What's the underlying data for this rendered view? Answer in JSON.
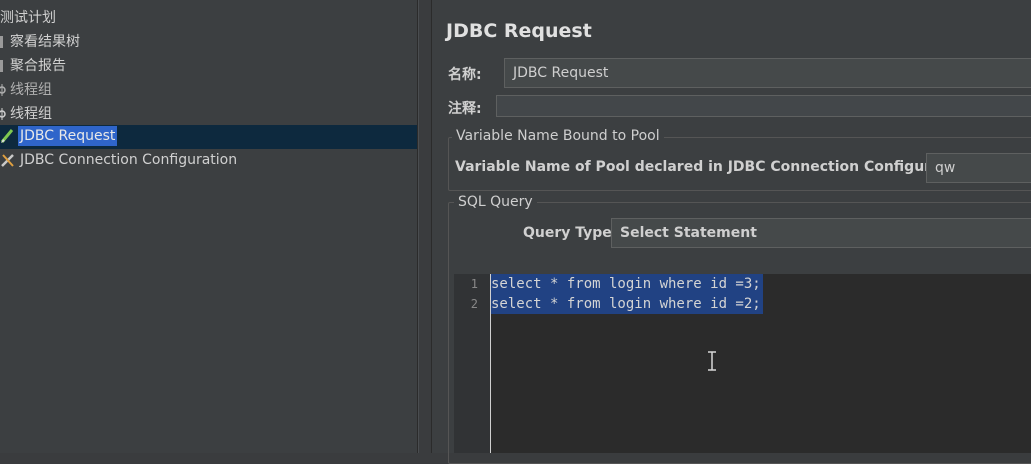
{
  "tree": {
    "items": [
      {
        "label": "测试计划",
        "icon": "test-plan-icon"
      },
      {
        "label": "察看结果树",
        "icon": "listener-icon"
      },
      {
        "label": "聚合报告",
        "icon": "listener-icon"
      },
      {
        "label": "线程组",
        "icon": "thread-group-icon"
      },
      {
        "label": "线程组",
        "icon": "thread-group-icon"
      },
      {
        "label": "JDBC Request",
        "icon": "sampler-pencil-icon"
      },
      {
        "label": "JDBC Connection Configuration",
        "icon": "config-wrench-icon"
      }
    ]
  },
  "panel": {
    "title": "JDBC Request",
    "name_label": "名称:",
    "name_value": "JDBC Request",
    "comment_label": "注释:",
    "comment_value": "",
    "pool_group": {
      "title": "Variable Name Bound to Pool",
      "label": "Variable Name of Pool declared in JDBC Connection Configuration:",
      "value": "qw"
    },
    "sql_group": {
      "title": "SQL Query",
      "query_type_label": "Query Type:",
      "query_type_value": "Select Statement"
    },
    "editor": {
      "lines": [
        {
          "num": "1",
          "code": "select * from login where id =3;"
        },
        {
          "num": "2",
          "code": "select * from login where id =2;"
        }
      ]
    }
  },
  "colors": {
    "selection": "#2f65ca",
    "code_selection": "#214283",
    "background": "#3c3f41"
  }
}
